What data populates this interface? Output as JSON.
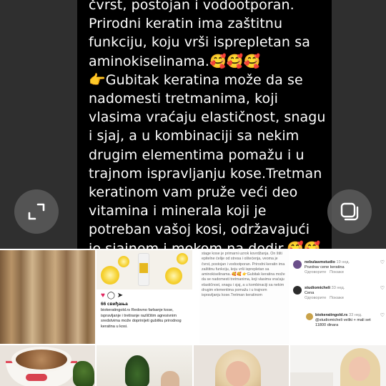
{
  "viewer": {
    "post_text": "čvrst, postojan i vodootporan.\nPrirodni keratin ima zaštitnu funkciju, koju vrši isprepletan sa aminokiselinama.🥰🥰🥰\n👉Gubitak keratina može da se nadomesti tretmanima, koji vlasima vraćaju elastičnost, snagu i sjaj, a u kombinaciji sa nekim drugim elementima pomažu i u trajnom ispravljanju kose.Tretman keratinom vam pruže veći deo vitamina i minerala koji je potreban vašoj kosi, održavajući je sjajnom i mekom na dodir.🥰🥰",
    "expand_icon": "expand-icon",
    "copy_icon": "copy-icon"
  },
  "grid": {
    "insta": {
      "likes": "66 свиђања",
      "caption": "biokeratingold.rs Redovno farbanje kose, ispravljanje i tretiranje različitim agresivnim sredstvima može doprinijeti gubitku prirodnog keratina u kosi."
    },
    "mini_text": "stage kose je primarni uzrok kovrdžanja. On štiti epitelne ćelije od stresa i oštećenja, veoma je čvrst, postojan i vodootporan. Prirodni keratin ima zaštitnu funkciju, koju vrši isprepletan sa aminokiselinama. 🥰🥰\n👉Gubitak keratina može da se nadomesti tretmanima, koji vlasima vraćaju elastičnost, snagu i sjaj, a u kombinaciji sa nekim drugim elementima pomažu i u trajnom ispravljanju kose.Tretman keratinom",
    "comments": [
      {
        "user": "nebulasmstudio",
        "time": "19 нед.",
        "text": "Pozdrav cene keratina",
        "reply": "Одговорите",
        "see": "Покажи"
      },
      {
        "user": "studiomicheli",
        "time": "33 нед.",
        "text": "Cena",
        "reply": "Одговорите",
        "see": "Покажи"
      },
      {
        "user": "biokeratingold.rs",
        "time": "33 нед.",
        "text": "@studiomicheli veliki + mali set 11800 dinara",
        "reply": "",
        "see": ""
      }
    ]
  }
}
